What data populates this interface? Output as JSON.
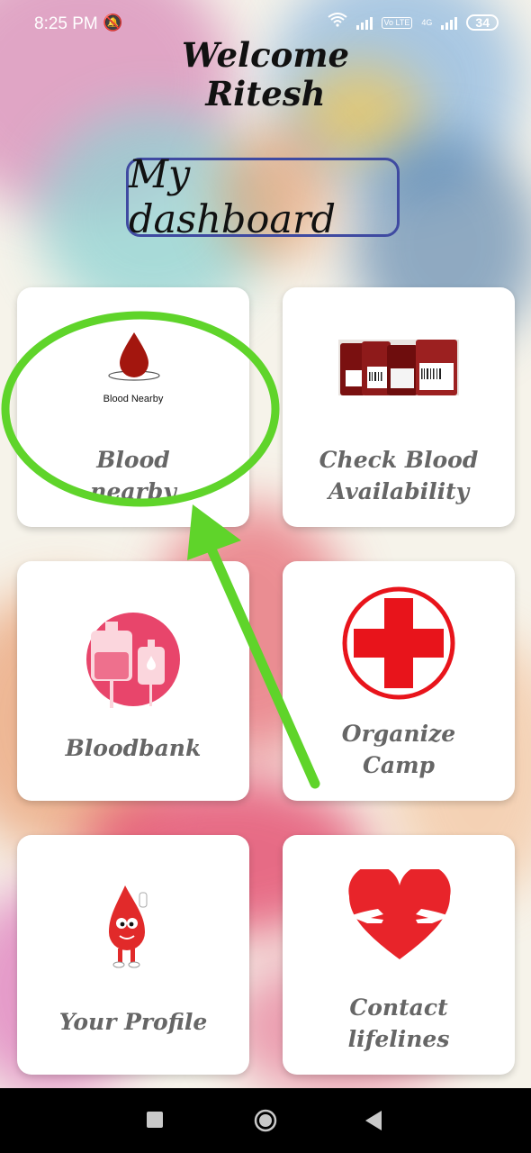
{
  "status_bar": {
    "time": "8:25 PM",
    "battery": "34",
    "network": "4G",
    "volte": "Vo LTE"
  },
  "header": {
    "welcome_line1": "Welcome",
    "welcome_line2": "Ritesh",
    "dashboard_title": "My dashboard"
  },
  "cards": [
    {
      "label": "Blood\nnearby",
      "image_caption": "Blood Nearby",
      "icon": "blood-drop-icon"
    },
    {
      "label": "Check Blood\nAvailability",
      "icon": "blood-bags-photo"
    },
    {
      "label": "Bloodbank",
      "icon": "blood-bag-icon"
    },
    {
      "label": "Organize\nCamp",
      "icon": "red-cross-icon"
    },
    {
      "label": "Your Profile",
      "icon": "blood-drop-mascot-icon"
    },
    {
      "label": "Contact\nlifelines",
      "icon": "heart-hands-icon"
    }
  ],
  "annotation": {
    "color": "#5fd42a"
  },
  "colors": {
    "accent_border": "#3f4aa1",
    "label_gray": "#666666",
    "blood_red": "#a3160e",
    "cross_red": "#e8141b"
  }
}
